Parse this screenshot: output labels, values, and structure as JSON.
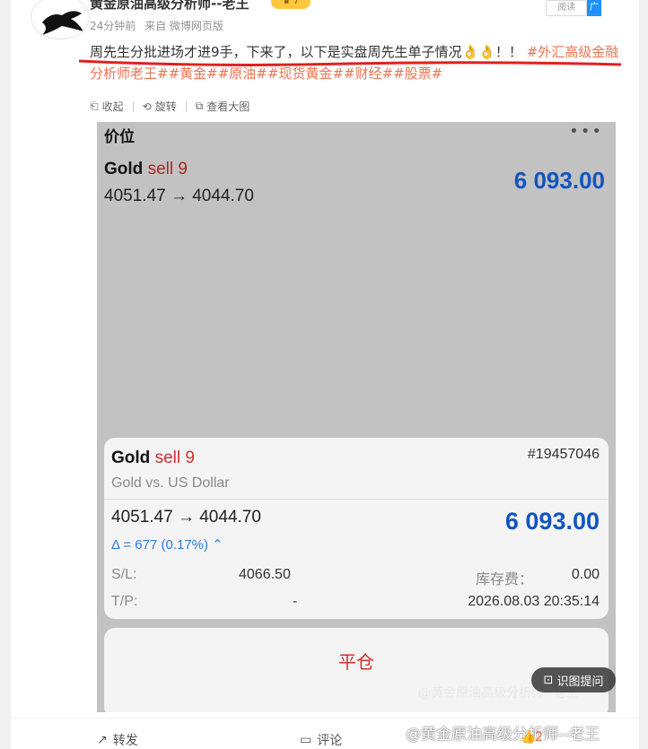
{
  "author": {
    "name": "黄金原油高级分析师--老王",
    "time": "24分钟前",
    "source": "来自 微博网页版",
    "read_label": "阅读",
    "ad_label": "广"
  },
  "post": {
    "text": "周先生分批进场才进9手，下来了，以下是实盘周先生单子情况",
    "emoji": "👌👌",
    "exclaim": "！！",
    "tags": "#外汇高级金融分析师老王##黄金##原油##现货黄金##财经##股票#"
  },
  "tools": {
    "collapse": "收起",
    "rotate": "旋转",
    "view_large": "查看大图"
  },
  "trade": {
    "section_title": "价位",
    "menu_dots": "•••",
    "symbol": "Gold",
    "side": "sell 9",
    "price_change": "4051.47 → 4044.70",
    "profit": "6 093.00",
    "order_id": "#19457046",
    "description": "Gold vs. US Dollar",
    "delta": "Δ = 677 (0.17%) ⌃",
    "sl_label": "S/L:",
    "sl_value": "4066.50",
    "tp_label": "T/P:",
    "tp_value": "-",
    "swap_label": "库存费：",
    "swap_value": "0.00",
    "timestamp": "2026.08.03 20:35:14",
    "close_label": "平仓"
  },
  "image_overlay": {
    "watermark": "@黄金原油高级分析师--老王",
    "ask_label": "识图提问"
  },
  "footer": {
    "repost": "转发",
    "comment": "评论",
    "like_count": "2",
    "watermark": "@黄金原油高级分析师--老王"
  },
  "colors": {
    "tag": "#eb7350",
    "profit": "#1255c0",
    "sell": "#d0302f",
    "delta": "#2a7cd8"
  }
}
